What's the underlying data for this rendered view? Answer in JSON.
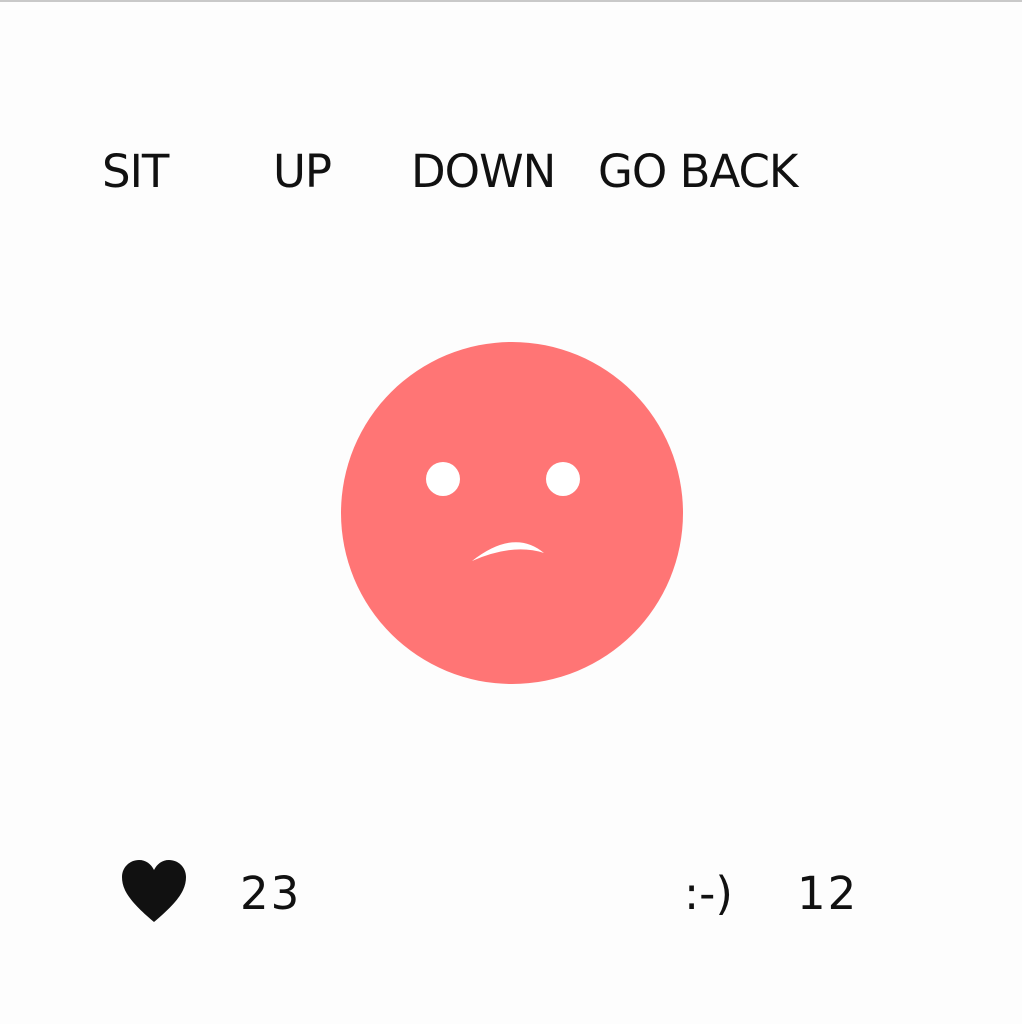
{
  "commands": {
    "sit": "SIT",
    "up": "UP",
    "down": "DOWN",
    "go_back": "GO BACK"
  },
  "pet": {
    "mood": "sad",
    "face_color": "#ff7575",
    "feature_color": "#ffffff"
  },
  "stats": {
    "love": {
      "icon": "heart-icon",
      "value": "23"
    },
    "happiness": {
      "label": ":-)",
      "value": "12"
    }
  }
}
